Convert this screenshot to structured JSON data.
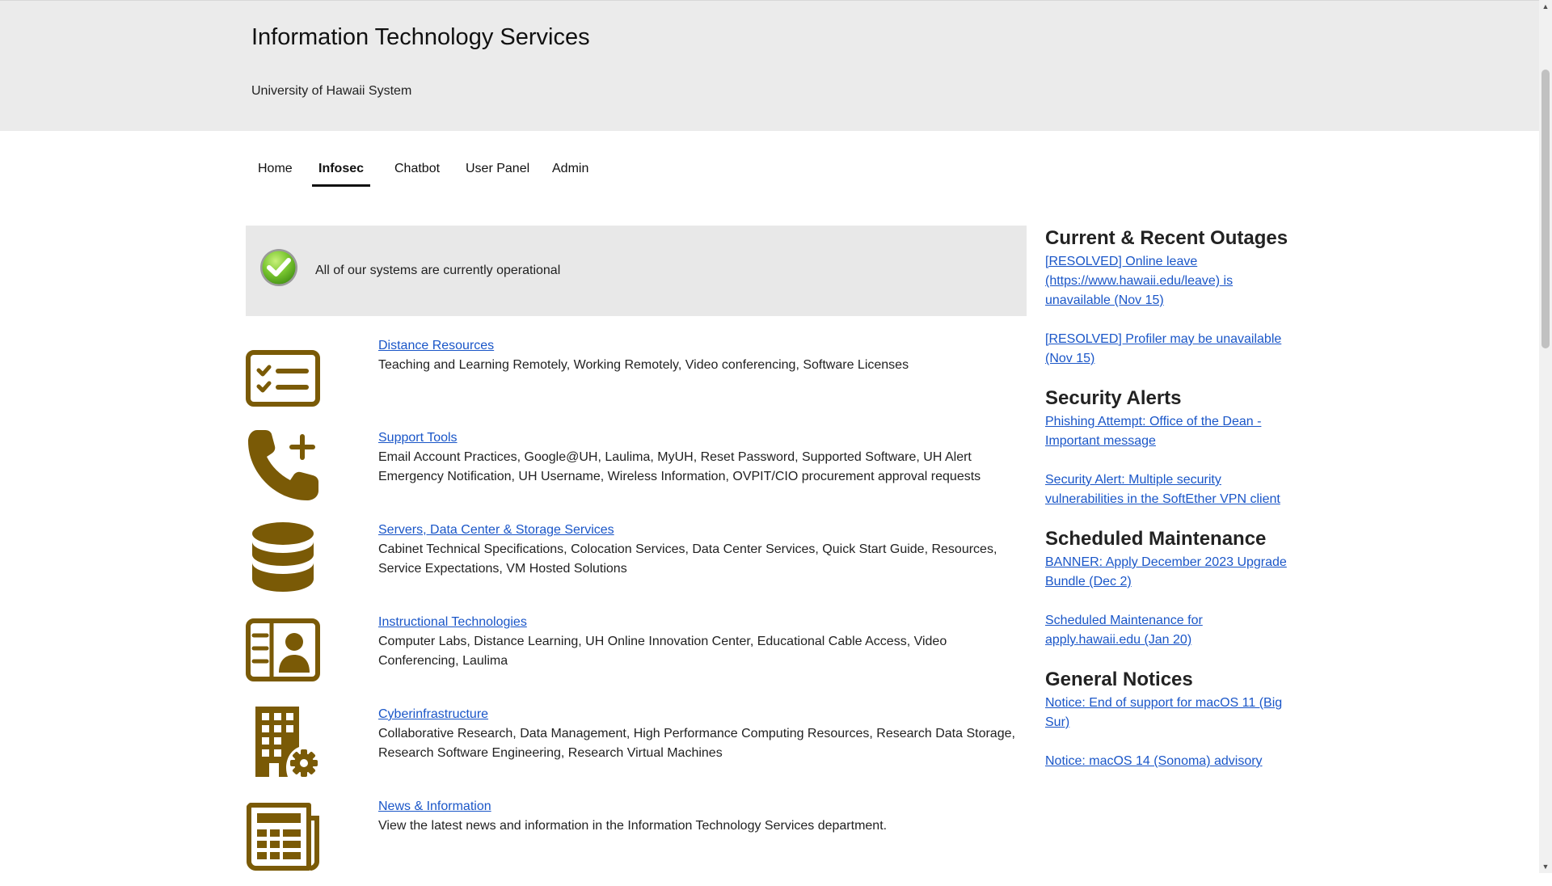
{
  "header": {
    "title": "Information Technology Services",
    "subtitle": "University of Hawaii System"
  },
  "nav": {
    "items": [
      {
        "label": "Home"
      },
      {
        "label": "Infosec",
        "active": true
      },
      {
        "label": "Chatbot"
      },
      {
        "label": "User Panel"
      },
      {
        "label": "Admin"
      }
    ]
  },
  "status": {
    "icon": "check-circle-icon",
    "text": "All of our systems are currently operational",
    "color": "#6fbf2a"
  },
  "theme": {
    "icon_color": "#7a5a06",
    "link_color": "#1a56c8"
  },
  "services": [
    {
      "icon": "checklist-icon",
      "title": "Distance Resources",
      "description": "Teaching and Learning Remotely, Working Remotely, Video conferencing, Software Licenses"
    },
    {
      "icon": "phone-plus-icon",
      "title": "Support Tools",
      "description": "Email Account Practices, Google@UH, Laulima, MyUH, Reset Password, Supported Software, UH Alert Emergency Notification, UH Username, Wireless Information, OVPIT/CIO procurement approval requests"
    },
    {
      "icon": "database-icon",
      "title": "Servers, Data Center & Storage Services",
      "description": "Cabinet Technical Specifications, Colocation Services, Data Center Services, Quick Start Guide, Resources, Service Expectations, VM Hosted Solutions"
    },
    {
      "icon": "id-card-icon",
      "title": "Instructional Technologies",
      "description": "Computer Labs, Distance Learning, UH Online Innovation Center, Educational Cable Access, Video Conferencing, Laulima"
    },
    {
      "icon": "building-gear-icon",
      "title": "Cyberinfrastructure",
      "description": "Collaborative Research, Data Management, High Performance Computing Resources, Research Data Storage, Research Software Engineering, Research Virtual Machines"
    },
    {
      "icon": "newspaper-icon",
      "title": "News & Information",
      "description": "View the latest news and information in the Information Technology Services department."
    }
  ],
  "sidebar": {
    "sections": [
      {
        "heading": "Current & Recent Outages",
        "links": [
          "[RESOLVED] Online leave (https://www.hawaii.edu/leave) is unavailable (Nov 15)",
          "[RESOLVED] Profiler may be unavailable (Nov 15)"
        ]
      },
      {
        "heading": "Security Alerts",
        "links": [
          "Phishing Attempt: Office of the Dean - Important message",
          "Security Alert: Multiple security vulnerabilities in the SoftEther VPN client"
        ]
      },
      {
        "heading": "Scheduled Maintenance",
        "links": [
          "BANNER: Apply December 2023 Upgrade Bundle (Dec 2)",
          "Scheduled Maintenance for apply.hawaii.edu (Jan 20)"
        ]
      },
      {
        "heading": "General Notices",
        "links": [
          "Notice: End of support for macOS 11 (Big Sur)",
          "Notice: macOS 14 (Sonoma) advisory"
        ]
      }
    ]
  },
  "scrollbar": {
    "up_arrow": "▲",
    "down_arrow": "▼"
  }
}
